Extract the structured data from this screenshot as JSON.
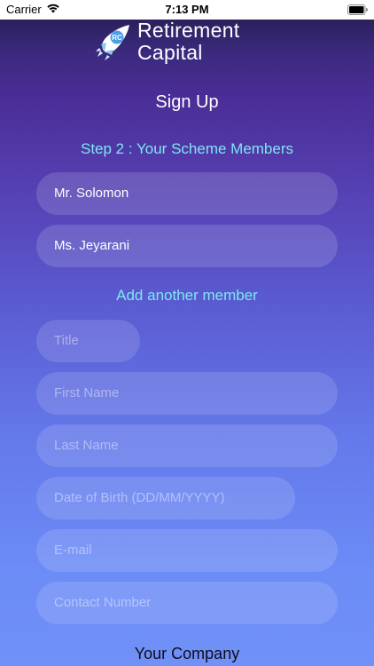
{
  "status_bar": {
    "carrier": "Carrier",
    "time": "7:13 PM",
    "wifi_icon": "wifi-icon",
    "battery_icon": "battery-icon"
  },
  "brand": {
    "name": "Retirement\nCapital",
    "logo_icon": "rocket-logo-icon",
    "accent_color": "#7ee6f0"
  },
  "page": {
    "title": "Sign Up",
    "step": "Step 2 : Your Scheme Members"
  },
  "members": [
    {
      "name": "Mr. Solomon"
    },
    {
      "name": "Ms. Jeyarani"
    }
  ],
  "add_member_label": "Add another member",
  "form": {
    "title_placeholder": "Title",
    "first_name_placeholder": "First Name",
    "last_name_placeholder": "Last Name",
    "dob_placeholder": "Date of Birth (DD/MM/YYYY)",
    "email_placeholder": "E-mail",
    "contact_placeholder": "Contact Number"
  },
  "next_section_title": "Your Company"
}
